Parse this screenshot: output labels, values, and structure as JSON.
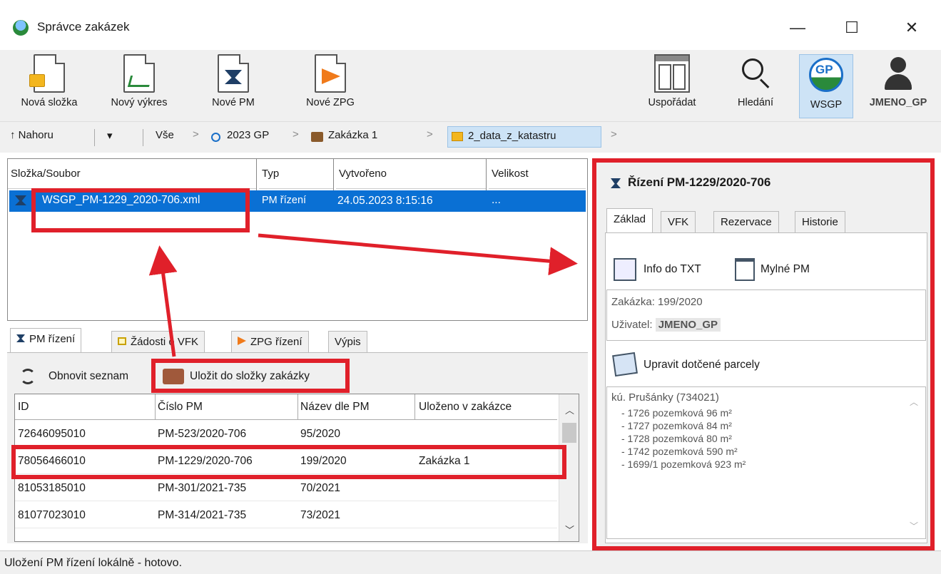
{
  "window": {
    "title": "Správce zakázek",
    "minimize": "—",
    "maximize": "☐",
    "close": "✕"
  },
  "toolbar": {
    "items": [
      {
        "label": "Nová složka",
        "icon": "new-folder-icon"
      },
      {
        "label": "Nový výkres",
        "icon": "new-drawing-icon"
      },
      {
        "label": "Nové PM",
        "icon": "new-pm-icon"
      },
      {
        "label": "Nové ZPG",
        "icon": "new-zpg-icon"
      },
      {
        "label": "Uspořádat",
        "icon": "layout-icon"
      },
      {
        "label": "Hledání",
        "icon": "search-icon"
      },
      {
        "label": "WSGP",
        "icon": "wsgp-logo-icon"
      },
      {
        "label": "JMENO_GP",
        "icon": "user-icon"
      }
    ],
    "wsgp_logo_text": "GP"
  },
  "breadcrumb": {
    "up": "↑ Nahoru",
    "dropdown": "▾",
    "all": "Vše",
    "items": [
      "2023 GP",
      "Zakázka 1",
      "2_data_z_katastru"
    ],
    "sep": ">"
  },
  "files": {
    "columns": [
      "Složka/Soubor",
      "Typ",
      "Vytvořeno",
      "Velikost"
    ],
    "rows": [
      {
        "name": "WSGP_PM-1229_2020-706.xml",
        "type": "PM řízení",
        "created": "24.05.2023 8:15:16",
        "size": "..."
      }
    ]
  },
  "bottom_tabs": [
    "PM řízení",
    "Žádosti o VFK",
    "ZPG řízení",
    "Výpis"
  ],
  "bottom_actions": {
    "refresh": "Obnovit seznam",
    "save": "Uložit do složky zakázky"
  },
  "pm_table": {
    "columns": [
      "ID",
      "Číslo PM",
      "Název dle PM",
      "Uloženo v zakázce"
    ],
    "rows": [
      {
        "id": "72646095010",
        "cislo": "PM-523/2020-706",
        "nazev": "95/2020",
        "ulozeno": ""
      },
      {
        "id": "78056466010",
        "cislo": "PM-1229/2020-706",
        "nazev": "199/2020",
        "ulozeno": "Zakázka 1"
      },
      {
        "id": "81053185010",
        "cislo": "PM-301/2021-735",
        "nazev": "70/2021",
        "ulozeno": ""
      },
      {
        "id": "81077023010",
        "cislo": "PM-314/2021-735",
        "nazev": "73/2021",
        "ulozeno": ""
      }
    ]
  },
  "detail": {
    "title": "Řízení PM-1229/2020-706",
    "tabs": [
      "Základ",
      "VFK",
      "Rezervace",
      "Historie"
    ],
    "info_txt": "Info do TXT",
    "mylne": "Mylné PM",
    "zakazka_label": "Zakázka:",
    "zakazka_value": "199/2020",
    "uzivatel_label": "Uživatel:",
    "uzivatel_value": "JMENO_GP",
    "edit_parcels": "Upravit dotčené parcely",
    "parcels_header": "kú. Prušánky (734021)",
    "parcels": [
      "- 1726 pozemková 96 m²",
      "- 1727 pozemková 84 m²",
      "- 1728 pozemková 80 m²",
      "- 1742 pozemková 590 m²",
      "- 1699/1 pozemková 923 m²"
    ]
  },
  "status": {
    "text": "Uložení PM řízení lokálně - hotovo."
  },
  "colors": {
    "highlight": "#e0202a",
    "selection": "#0a70d4"
  }
}
